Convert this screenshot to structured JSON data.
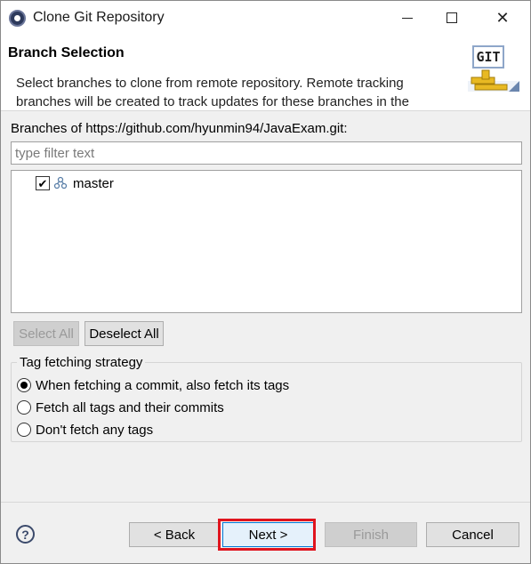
{
  "window": {
    "title": "Clone Git Repository"
  },
  "header": {
    "title": "Branch Selection",
    "description": "Select branches to clone from remote repository. Remote tracking branches will be created to track updates for these branches in the",
    "logo_text": "GIT"
  },
  "branches": {
    "label": "Branches of https://github.com/hyunmin94/JavaExam.git:",
    "filter_placeholder": "type filter text",
    "items": [
      {
        "name": "master",
        "checked": true
      }
    ],
    "select_all_label": "Select All",
    "deselect_all_label": "Deselect All"
  },
  "tag_fetching": {
    "title": "Tag fetching strategy",
    "options": [
      {
        "label": "When fetching a commit, also fetch its tags",
        "selected": true
      },
      {
        "label": "Fetch all tags and their commits",
        "selected": false
      },
      {
        "label": "Don't fetch any tags",
        "selected": false
      }
    ]
  },
  "footer": {
    "back_label": "< Back",
    "next_label": "Next >",
    "finish_label": "Finish",
    "cancel_label": "Cancel"
  },
  "colors": {
    "highlight": "#e0141e",
    "accent": "#0078d7"
  },
  "icons": {
    "app": "eclipse-icon",
    "help": "help-icon",
    "branch": "branch-icon"
  }
}
